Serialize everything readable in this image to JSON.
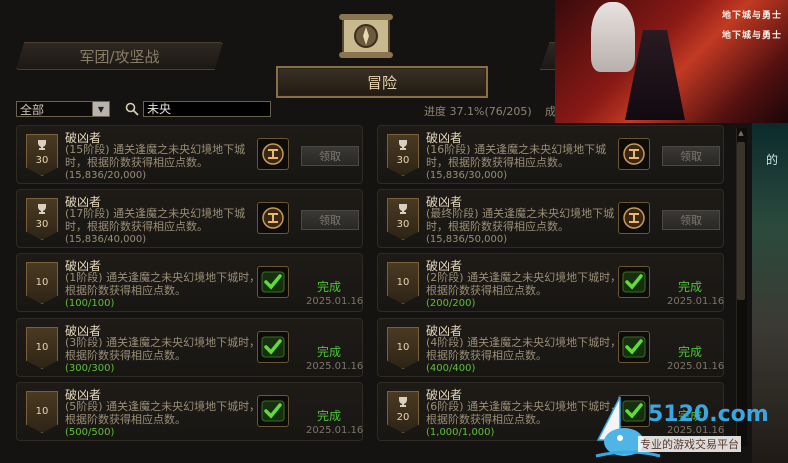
{
  "header": {
    "tab_left": "军团/攻坚战",
    "tab_active": "冒险"
  },
  "filter": {
    "select_value": "全部",
    "search_value": "未央",
    "progress_text": "进度 37.1%(76/205)",
    "cut_text": "成"
  },
  "cards": [
    {
      "title": "破凶者",
      "badge": "30",
      "desc": "(15阶段) 通关逢魔之未央幻境地下城时，根据阶数获得相应点数。",
      "progress": "(15,836/20,000)",
      "done": false,
      "action": "领取",
      "trophy": true
    },
    {
      "title": "破凶者",
      "badge": "30",
      "desc": "(16阶段) 通关逢魔之未央幻境地下城时，根据阶数获得相应点数。",
      "progress": "(15,836/30,000)",
      "done": false,
      "action": "领取",
      "trophy": true
    },
    {
      "title": "破凶者",
      "badge": "30",
      "desc": "(17阶段) 通关逢魔之未央幻境地下城时，根据阶数获得相应点数。",
      "progress": "(15,836/40,000)",
      "done": false,
      "action": "领取",
      "trophy": true
    },
    {
      "title": "破凶者",
      "badge": "30",
      "desc": "(最终阶段) 通关逢魔之未央幻境地下城时，根据阶数获得相应点数。",
      "progress": "(15,836/50,000)",
      "done": false,
      "action": "领取",
      "trophy": true
    },
    {
      "title": "破凶者",
      "badge": "10",
      "desc": "(1阶段) 通关逢魔之未央幻境地下城时，根据阶数获得相应点数。",
      "progress": "(100/100)",
      "done": true,
      "action": "完成",
      "date": "2025.01.16",
      "trophy": false
    },
    {
      "title": "破凶者",
      "badge": "10",
      "desc": "(2阶段) 通关逢魔之未央幻境地下城时，根据阶数获得相应点数。",
      "progress": "(200/200)",
      "done": true,
      "action": "完成",
      "date": "2025.01.16",
      "trophy": false
    },
    {
      "title": "破凶者",
      "badge": "10",
      "desc": "(3阶段) 通关逢魔之未央幻境地下城时，根据阶数获得相应点数。",
      "progress": "(300/300)",
      "done": true,
      "action": "完成",
      "date": "2025.01.16",
      "trophy": false
    },
    {
      "title": "破凶者",
      "badge": "10",
      "desc": "(4阶段) 通关逢魔之未央幻境地下城时，根据阶数获得相应点数。",
      "progress": "(400/400)",
      "done": true,
      "action": "完成",
      "date": "2025.01.16",
      "trophy": false
    },
    {
      "title": "破凶者",
      "badge": "10",
      "desc": "(5阶段) 通关逢魔之未央幻境地下城时，根据阶数获得相应点数。",
      "progress": "(500/500)",
      "done": true,
      "action": "完成",
      "date": "2025.01.16",
      "trophy": false
    },
    {
      "title": "破凶者",
      "badge": "20",
      "desc": "(6阶段) 通关逢魔之未央幻境地下城时，根据阶数获得相应点数。",
      "progress": "(1,000/1,000)",
      "done": true,
      "action": "完成",
      "date": "2025.01.16",
      "trophy": true
    }
  ],
  "ad": {
    "logo_text_1": "地下城与勇士",
    "logo_text_2": "地下城与勇士",
    "side_text": "的"
  },
  "watermark": {
    "site": "5120.com",
    "slogan": "专业的游戏交易平台"
  },
  "colors": {
    "accent_gold": "#8a6e45",
    "done_green": "#4fc33a",
    "background": "#151311"
  }
}
